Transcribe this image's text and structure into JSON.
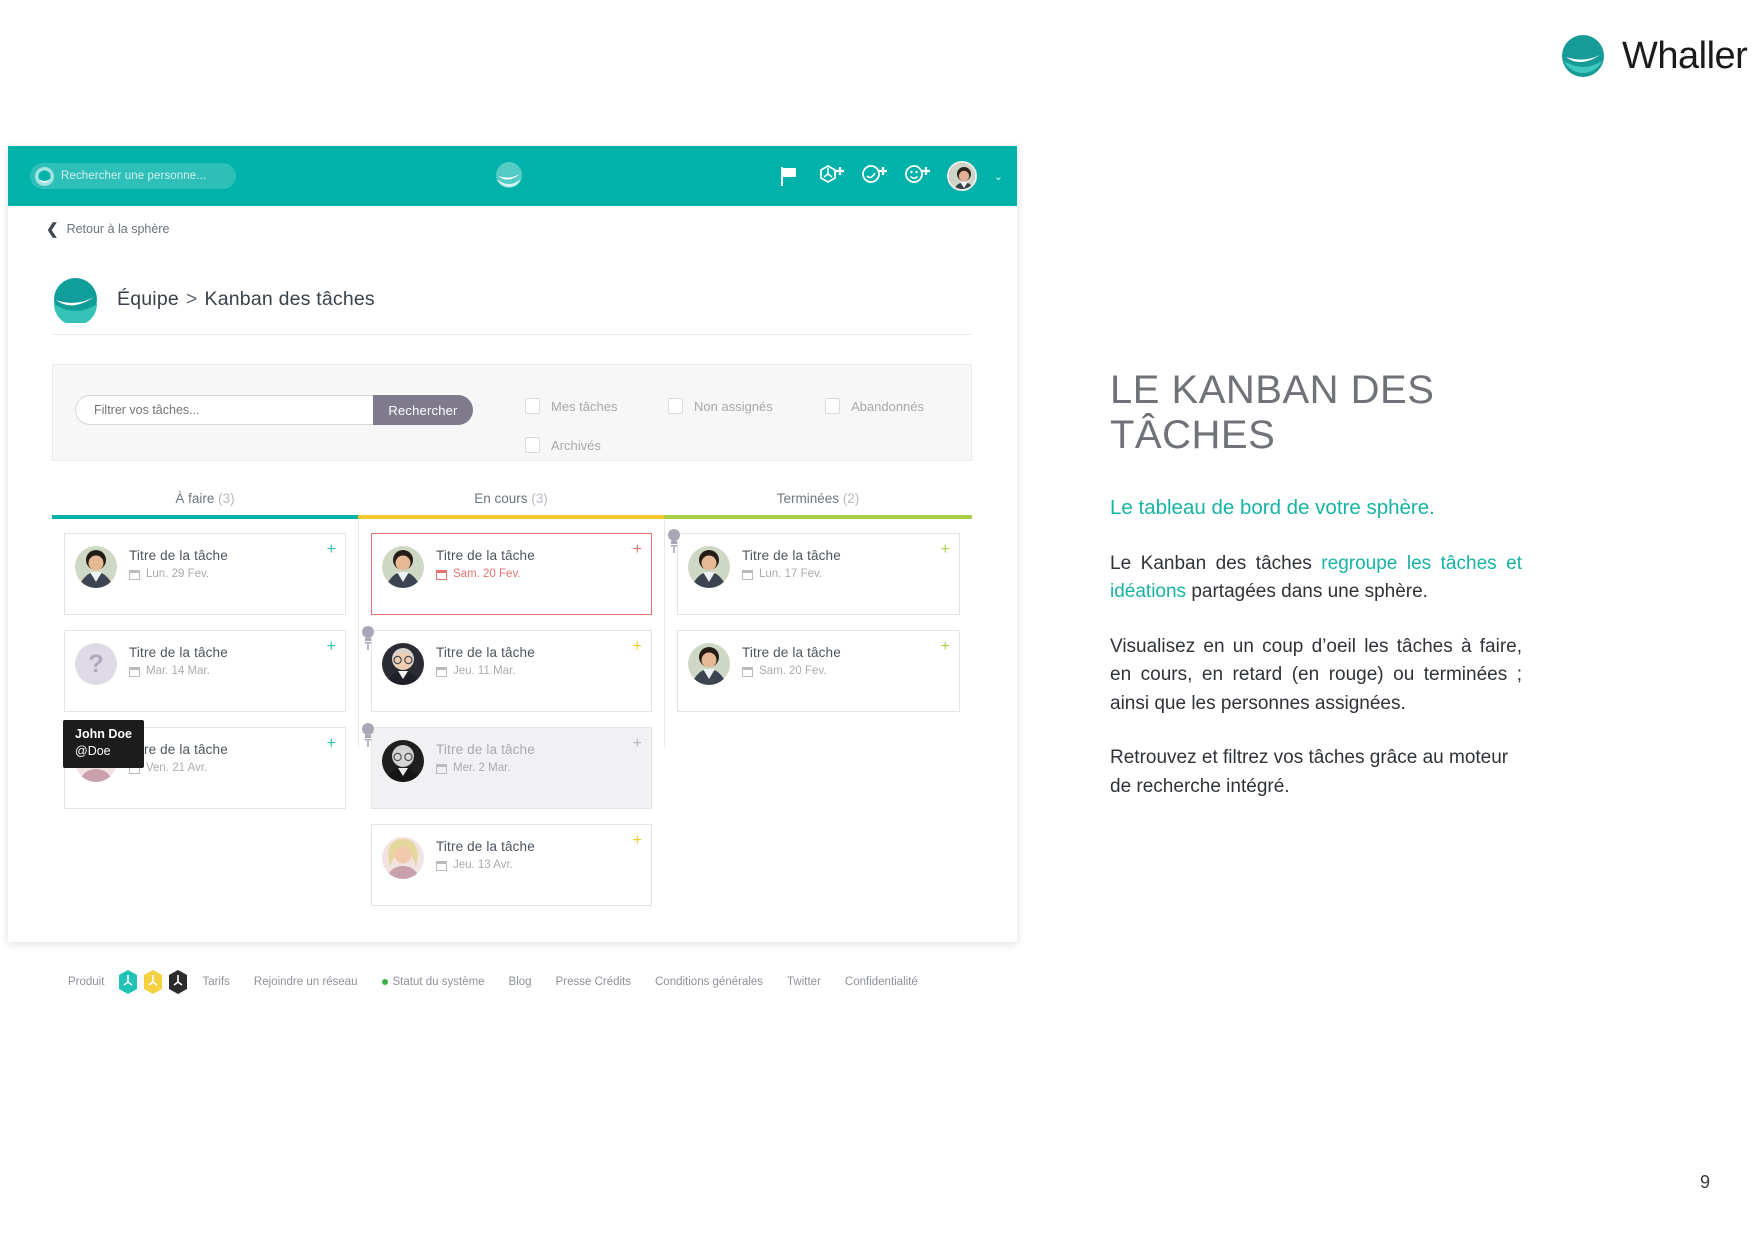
{
  "brand": {
    "name": "Whaller"
  },
  "topbar": {
    "search_placeholder": "Rechercher une personne...",
    "icons": [
      "flag-icon",
      "add-sphere-icon",
      "add-circle-icon",
      "add-person-icon"
    ],
    "avatar_name": "user-avatar",
    "chevron": "⌄"
  },
  "back": {
    "label": "Retour à la sphère",
    "arrow": "❮"
  },
  "breadcrumb": {
    "sphere": "Équipe",
    "separator": ">",
    "page": "Kanban des tâches"
  },
  "filters": {
    "input_placeholder": "Filtrer vos tâches...",
    "input_value": "",
    "search_button": "Rechercher",
    "checkboxes": [
      {
        "label": "Mes tâches",
        "checked": false
      },
      {
        "label": "Non assignés",
        "checked": false
      },
      {
        "label": "Abandonnés",
        "checked": false
      },
      {
        "label": "Archivés",
        "checked": false
      }
    ]
  },
  "kanban": {
    "columns": [
      {
        "title": "À faire",
        "count": "(3)",
        "accent": "#00b2a9",
        "cards": [
          {
            "title": "Titre de la tâche",
            "date": "Lun. 29 Fev.",
            "late": false,
            "idea": false,
            "muted": false,
            "avatar": "photo",
            "plus": "teal"
          },
          {
            "title": "Titre de la tâche",
            "date": "Mar. 14 Mar.",
            "late": false,
            "idea": false,
            "muted": false,
            "avatar": "unassigned",
            "plus": "teal"
          },
          {
            "title": "Titre de la tâche",
            "date": "Ven. 21 Avr.",
            "late": false,
            "idea": false,
            "muted": false,
            "avatar": "photo",
            "plus": "teal"
          }
        ]
      },
      {
        "title": "En cours",
        "count": "(3)",
        "accent": "#f7c82b",
        "cards": [
          {
            "title": "Titre de la tâche",
            "date": "Sam. 20 Fev.",
            "late": true,
            "idea": false,
            "muted": false,
            "avatar": "photo",
            "plus": "red"
          },
          {
            "title": "Titre de la tâche",
            "date": "Jeu. 11 Mar.",
            "late": false,
            "idea": true,
            "muted": false,
            "avatar": "photo",
            "plus": "yellow"
          },
          {
            "title": "Titre de la tâche",
            "date": "Mer. 2 Mar.",
            "late": false,
            "idea": true,
            "muted": true,
            "avatar": "photo",
            "plus": "grey"
          },
          {
            "title": "Titre de la tâche",
            "date": "Jeu. 13 Avr.",
            "late": false,
            "idea": false,
            "muted": false,
            "avatar": "photo",
            "plus": "yellow"
          }
        ]
      },
      {
        "title": "Terminées",
        "count": "(2)",
        "accent": "#a9cf47",
        "cards": [
          {
            "title": "Titre de la tâche",
            "date": "Lun. 17 Fev.",
            "late": false,
            "idea": true,
            "muted": false,
            "avatar": "photo",
            "plus": "lime"
          },
          {
            "title": "Titre de la tâche",
            "date": "Sam. 20 Fev.",
            "late": false,
            "idea": false,
            "muted": false,
            "avatar": "photo",
            "plus": "lime"
          }
        ]
      }
    ]
  },
  "tooltip": {
    "name": "John Doe",
    "handle": "@Doe"
  },
  "footer": {
    "produit": "Produit",
    "links": [
      "Tarifs",
      "Rejoindre un réseau",
      "Statut du système",
      "Blog",
      "Presse Crédits",
      "Conditions générales",
      "Twitter",
      "Confidentialité"
    ]
  },
  "panel": {
    "title": "LE KANBAN DES TÂCHES",
    "lead": "Le tableau de bord de votre sphère.",
    "p1_a": "Le Kanban des tâches ",
    "p1_hl": "regroupe les tâches et idéations",
    "p1_b": " partagées dans une sphère.",
    "p2": "Visualisez en un coup d’oeil les tâches à faire, en cours, en retard (en rouge) ou terminées ; ainsi que les personnes assignées.",
    "p3": "Retrouvez et filtrez vos tâches grâce au moteur de recherche intégré."
  },
  "page_number": "9",
  "colors": {
    "teal": "#00b2a9",
    "brand_teal": "#17b3a3",
    "yellow": "#f7c82b",
    "lime": "#a9cf47",
    "red": "#e8736e",
    "grey_btn": "#7f7b8c"
  }
}
